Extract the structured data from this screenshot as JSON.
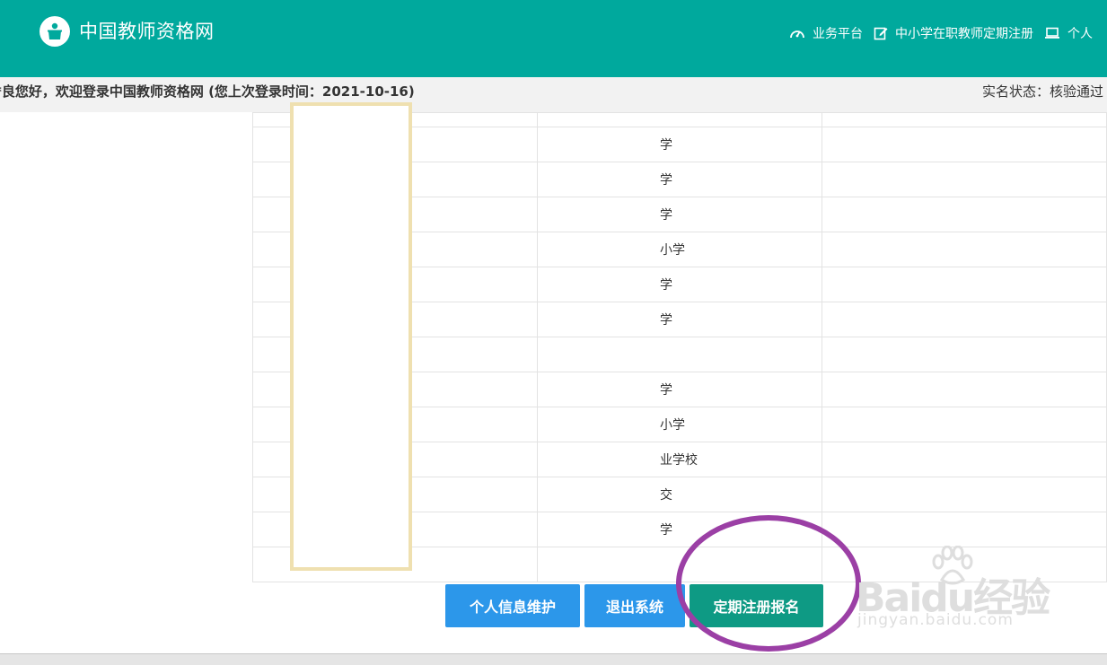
{
  "header": {
    "site_title": "中国教师资格网",
    "nav": [
      {
        "label": "业务平台",
        "icon": "dashboard-icon"
      },
      {
        "label": "中小学在职教师定期注册",
        "icon": "edit-icon"
      },
      {
        "label": "个人",
        "icon": "laptop-icon"
      }
    ]
  },
  "welcome": {
    "text": "*良您好，欢迎登录中国教师资格网 (您上次登录时间：2021-10-16)",
    "status": "实名状态：核验通过"
  },
  "table": {
    "rows": [
      {
        "name": "学"
      },
      {
        "name": "学"
      },
      {
        "name": "学"
      },
      {
        "name": "小学"
      },
      {
        "name": "学"
      },
      {
        "name": "学"
      },
      {
        "name": ""
      },
      {
        "name": "学"
      },
      {
        "name": "小学"
      },
      {
        "name": "业学校"
      },
      {
        "name": "交"
      },
      {
        "name": "学"
      },
      {
        "name": ""
      }
    ]
  },
  "buttons": {
    "info": "个人信息维护",
    "logout": "退出系统",
    "register": "定期注册报名"
  },
  "watermark": {
    "logo": "Baidu经验",
    "url": "jingyan.baidu.com"
  },
  "colors": {
    "header": "#00a99d",
    "button_blue": "#2c97ea",
    "button_green": "#0e9a84",
    "annotation": "#9b3fa5",
    "redaction_border": "#efe0b0"
  }
}
